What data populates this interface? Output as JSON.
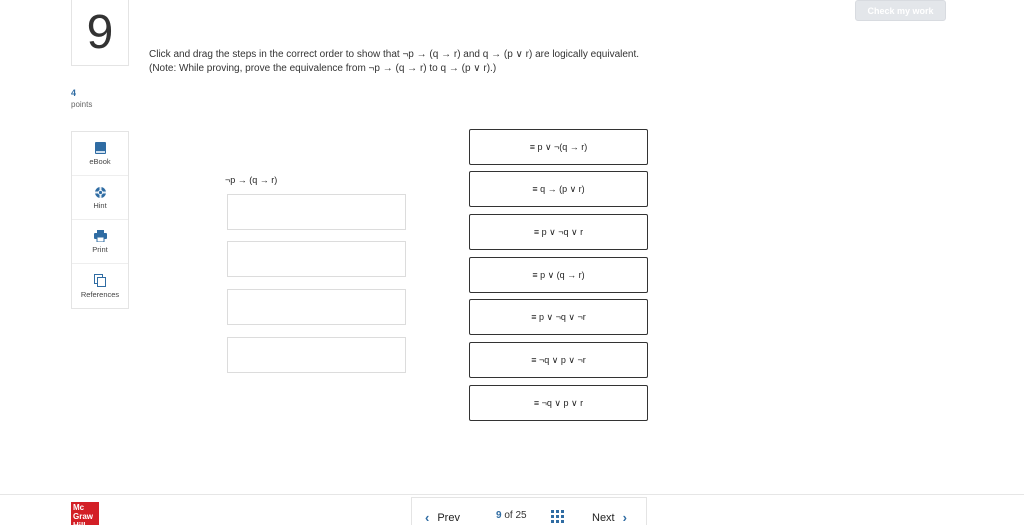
{
  "header": {
    "check_button": "Check my work",
    "question_number": "9"
  },
  "question": {
    "line1": "Click and drag the steps in the correct order to show that ¬p → (q → r) and q → (p ∨ r) are logically equivalent.",
    "line2": "(Note: While proving, prove the equivalence from ¬p → (q → r) to q → (p ∨ r).)",
    "points_value": "4",
    "points_label": "points"
  },
  "tools": [
    {
      "label": "eBook",
      "icon": "book-icon"
    },
    {
      "label": "Hint",
      "icon": "lifebuoy-icon"
    },
    {
      "label": "Print",
      "icon": "printer-icon"
    },
    {
      "label": "References",
      "icon": "references-icon"
    }
  ],
  "proof": {
    "start_expression": "¬p → (q → r)",
    "drop_slots": 4
  },
  "steps": [
    "≡ p ∨ ¬(q → r)",
    "≡ q → (p ∨ r)",
    "≡ p ∨ ¬q ∨ r",
    "≡ p ∨ (q → r)",
    "≡ p ∨ ¬q ∨ ¬r",
    "≡ ¬q ∨ p ∨ ¬r",
    "≡ ¬q ∨ p ∨ r"
  ],
  "footer": {
    "logo_text": "Mc Graw Hill",
    "prev_label": "Prev",
    "current_page": "9",
    "of_label": "of",
    "total_pages": "25",
    "next_label": "Next"
  },
  "colors": {
    "accent": "#2f6ca3",
    "logo_red": "#d31f26",
    "check_button_bg": "#e3e6ea"
  }
}
